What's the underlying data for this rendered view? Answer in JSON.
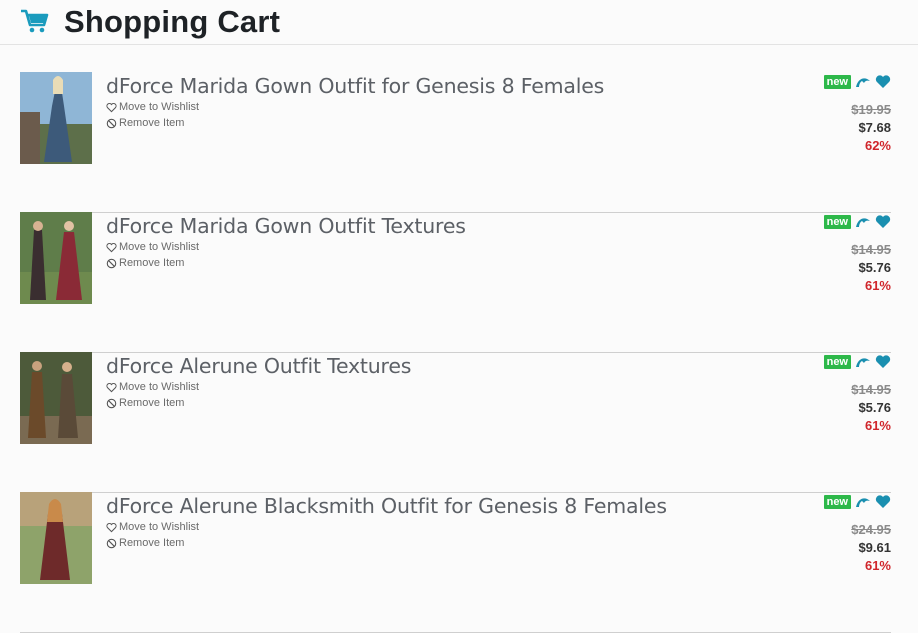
{
  "header": {
    "title": "Shopping Cart",
    "icon": "cart-icon",
    "accent": "#1a9bbd"
  },
  "actions": {
    "wishlist_label": "Move to Wishlist",
    "remove_label": "Remove Item"
  },
  "badge_label": "new",
  "colors": {
    "new_badge": "#2db84a",
    "discount": "#d0252b",
    "icons": "#1a8fb0"
  },
  "items": [
    {
      "name": "dForce Marida Gown Outfit for Genesis 8 Females",
      "old_price": "$19.95",
      "price": "$7.68",
      "discount": "62%"
    },
    {
      "name": "dForce Marida Gown Outfit Textures",
      "old_price": "$14.95",
      "price": "$5.76",
      "discount": "61%"
    },
    {
      "name": "dForce Alerune Outfit Textures",
      "old_price": "$14.95",
      "price": "$5.76",
      "discount": "61%"
    },
    {
      "name": "dForce Alerune Blacksmith Outfit for Genesis 8 Females",
      "old_price": "$24.95",
      "price": "$9.61",
      "discount": "61%"
    }
  ]
}
